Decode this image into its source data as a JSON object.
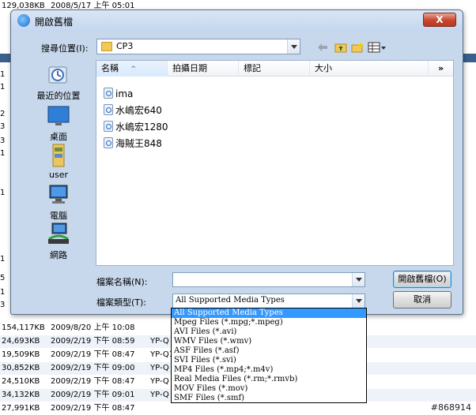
{
  "background": {
    "top_row": {
      "size": "129,038KB",
      "date": "2008/5/17 上午 05:01"
    },
    "rows": [
      {
        "size": "154,117KB",
        "date": "2009/8/20 上午 10:08",
        "ref": ""
      },
      {
        "size": "24,693KB",
        "date": "2009/2/19 下午 08:59",
        "ref": "YP-Q"
      },
      {
        "size": "19,509KB",
        "date": "2009/2/19 下午 08:47",
        "ref": "YP-Q1"
      },
      {
        "size": "30,852KB",
        "date": "2009/2/19 下午 09:00",
        "ref": "YP-Q"
      },
      {
        "size": "24,510KB",
        "date": "2009/2/19 下午 08:47",
        "ref": "YP-Q"
      },
      {
        "size": "34,132KB",
        "date": "2009/2/19 下午 09:01",
        "ref": "YP-Q"
      },
      {
        "size": "27,991KB",
        "date": "2009/2/19 下午 08:47",
        "ref": ""
      }
    ],
    "edge_numbers": [
      "1",
      "1",
      "2",
      "3",
      "3",
      "1",
      "1",
      "1",
      "5",
      "1",
      "3"
    ],
    "watermark": "#868914"
  },
  "dialog": {
    "title": "開啟舊檔",
    "close_label": "X",
    "lookin_label": "搜尋位置(I):",
    "lookin_value": "CP3",
    "places": [
      {
        "label": "最近的位置",
        "icon": "recent-places-icon"
      },
      {
        "label": "桌面",
        "icon": "desktop-icon"
      },
      {
        "label": "user",
        "icon": "user-folder-icon"
      },
      {
        "label": "電腦",
        "icon": "computer-icon"
      },
      {
        "label": "網路",
        "icon": "network-icon"
      }
    ],
    "columns": [
      "名稱",
      "拍攝日期",
      "標記",
      "大小"
    ],
    "more_columns": "»",
    "files": [
      "ima",
      "水嶋宏640",
      "水嶋宏1280",
      "海賊王848"
    ],
    "filename_label": "檔案名稱(N):",
    "filename_value": "",
    "filetype_label": "檔案類型(T):",
    "filetype_value": "All Supported Media Types",
    "open_button": "開啟舊檔(O)",
    "cancel_button": "取消",
    "filetype_options": [
      "All Supported Media Types",
      "Mpeg Files (*.mpg;*.mpeg)",
      "AVI Files (*.avi)",
      "WMV Files (*.wmv)",
      "ASF Files (*.asf)",
      "SVI Files (*.svi)",
      "MP4 Files (*.mp4;*.m4v)",
      "Real Media Files (*.rm;*.rmvb)",
      "MOV Files (*.mov)",
      "SMF Files (*.smf)"
    ],
    "selected_option_index": 0
  }
}
